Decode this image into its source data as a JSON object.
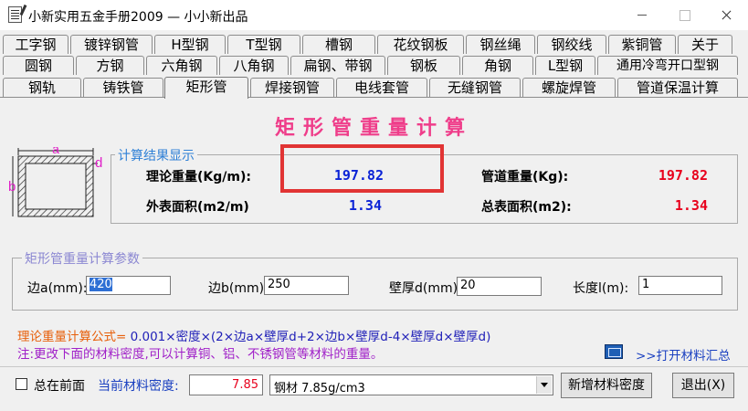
{
  "window": {
    "title": "小新实用五金手册2009 — 小小新出品"
  },
  "tabs": {
    "row1": [
      "工字钢",
      "镀锌钢管",
      "H型钢",
      "T型钢",
      "槽钢",
      "花纹钢板",
      "钢丝绳",
      "钢绞线",
      "紫铜管",
      "关于"
    ],
    "row2": [
      "圆钢",
      "方钢",
      "六角钢",
      "八角钢",
      "扁钢、带钢",
      "钢板",
      "角钢",
      "L型钢",
      "通用冷弯开口型钢"
    ],
    "row3": [
      "钢轨",
      "铸铁管",
      "矩形管",
      "焊接钢管",
      "电线套管",
      "无缝钢管",
      "螺旋焊管",
      "管道保温计算"
    ],
    "active": "矩形管"
  },
  "page": {
    "heading": "矩形管重量计算"
  },
  "diagram": {
    "label_a": "a",
    "label_b": "b",
    "label_d": "d"
  },
  "results": {
    "legend": "计算结果显示",
    "theory_weight_label": "理论重量(Kg/m):",
    "theory_weight_value": "197.82",
    "pipe_weight_label": "管道重量(Kg):",
    "pipe_weight_value": "197.82",
    "outer_area_label": "外表面积(m2/m)",
    "outer_area_value": "1.34",
    "total_area_label": "总表面积(m2):",
    "total_area_value": "1.34"
  },
  "params": {
    "legend": "矩形管重量计算参数",
    "side_a_label": "边a(mm):",
    "side_a_value": "420",
    "side_b_label": "边b(mm):",
    "side_b_value": "250",
    "thickness_label": "壁厚d(mm)",
    "thickness_value": "20",
    "length_label": "长度l(m):",
    "length_value": "1"
  },
  "formula": {
    "prefix": "理论重量计算公式=",
    "body": " 0.001×密度×(2×边a×壁厚d+2×边b×壁厚d-4×壁厚d×壁厚d)",
    "note": "注:更改下面的材料密度,可以计算铜、铝、不锈钢管等材料的重量。",
    "open_materials": ">>打开材料汇总"
  },
  "footer": {
    "always_on_top_label": "总在前面",
    "density_label": "当前材料密度:",
    "density_value": "7.85",
    "material_selected": "钢材 7.85g/cm3",
    "add_density_button": "新增材料密度",
    "exit_button": "退出(X)"
  },
  "colors": {
    "heading": "#ef3d8a",
    "value_blue": "#0b23d6",
    "value_red": "#e8001c",
    "highlight_box": "#e13434",
    "legend_blue": "#2f80d6"
  }
}
